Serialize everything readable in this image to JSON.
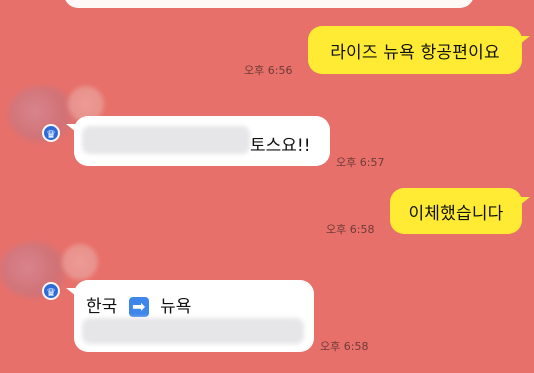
{
  "messages": [
    {
      "text": "라이즈 뉴욕 항공편이요",
      "time": "오후 6:56"
    },
    {
      "text": "토스요!!",
      "time": "오후 6:57"
    },
    {
      "text": "이체했습니다",
      "time": "오후 6:58"
    },
    {
      "from": "한국",
      "arrow": "➡",
      "to": "뉴욕",
      "time": "오후 6:58"
    }
  ],
  "colors": {
    "background": "#e8706a",
    "outgoing_bubble": "#ffeb33",
    "incoming_bubble": "#ffffff",
    "crown_badge": "#2e6bd8"
  },
  "icons": {
    "badge": "crown-icon",
    "arrow": "right-arrow-icon"
  }
}
